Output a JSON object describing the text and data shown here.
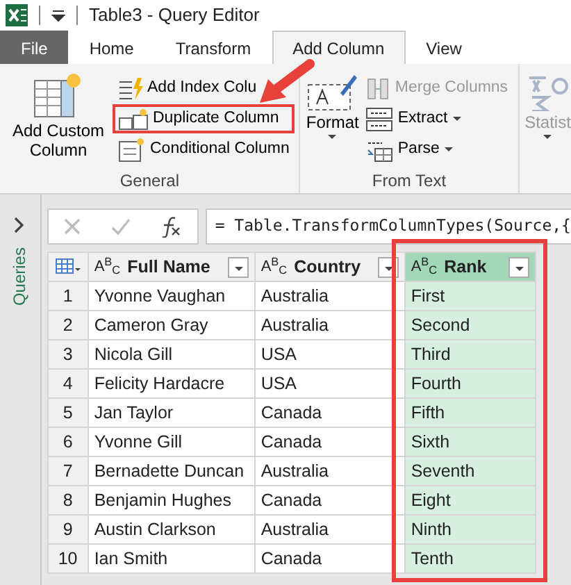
{
  "title_bar": {
    "title": "Table3 - Query Editor"
  },
  "tabs": [
    {
      "label": "File",
      "kind": "file",
      "selected": false
    },
    {
      "label": "Home",
      "kind": "tab",
      "selected": false
    },
    {
      "label": "Transform",
      "kind": "tab",
      "selected": false
    },
    {
      "label": "Add Column",
      "kind": "tab",
      "selected": true
    },
    {
      "label": "View",
      "kind": "tab",
      "selected": false
    }
  ],
  "ribbon": {
    "groups": [
      {
        "label": "General",
        "items": [
          {
            "kind": "large",
            "label": "Add Custom Column",
            "disabled": false,
            "dropdown": false,
            "highlighted": false
          },
          {
            "kind": "small",
            "label": "Add Index Colu",
            "disabled": false,
            "dropdown": false,
            "highlighted": false
          },
          {
            "kind": "small",
            "label": "Duplicate Column",
            "disabled": false,
            "dropdown": false,
            "highlighted": true
          },
          {
            "kind": "small",
            "label": "Conditional Column",
            "disabled": false,
            "dropdown": false,
            "highlighted": false
          }
        ]
      },
      {
        "label": "From Text",
        "items": [
          {
            "kind": "large",
            "label": "Format",
            "disabled": false,
            "dropdown": true,
            "highlighted": false
          },
          {
            "kind": "small",
            "label": "Merge Columns",
            "disabled": true,
            "dropdown": false,
            "highlighted": false
          },
          {
            "kind": "small",
            "label": "Extract",
            "disabled": false,
            "dropdown": true,
            "highlighted": false
          },
          {
            "kind": "small",
            "label": "Parse",
            "disabled": false,
            "dropdown": true,
            "highlighted": false
          }
        ]
      },
      {
        "items": [
          {
            "kind": "large",
            "label": "Statist",
            "disabled": true,
            "dropdown": true,
            "highlighted": false
          }
        ]
      }
    ]
  },
  "annotation_arrow": true,
  "queries_pane": {
    "label": "Queries"
  },
  "formula_bar": {
    "formula": "= Table.TransformColumnTypes(Source,{"
  },
  "table": {
    "columns": [
      {
        "type": "A$^{B}$$_{C}$",
        "name": "Full Name",
        "selected": false,
        "highlighted": false
      },
      {
        "type": "A$^{B}$$_{C}$",
        "name": "Country",
        "selected": false,
        "highlighted": false
      },
      {
        "type": "A$^{B}$$_{C}$",
        "name": "Rank",
        "selected": true,
        "highlighted": true
      }
    ],
    "rows": [
      {
        "number": "1",
        "cells": [
          "Yvonne Vaughan",
          "Australia",
          "First"
        ]
      },
      {
        "number": "2",
        "cells": [
          "Cameron Gray",
          "Australia",
          "Second"
        ]
      },
      {
        "number": "3",
        "cells": [
          "Nicola Gill",
          "USA",
          "Third"
        ]
      },
      {
        "number": "4",
        "cells": [
          "Felicity Hardacre",
          "USA",
          "Fourth"
        ]
      },
      {
        "number": "5",
        "cells": [
          "Jan Taylor",
          "Canada",
          "Fifth"
        ]
      },
      {
        "number": "6",
        "cells": [
          "Yvonne Gill",
          "Canada",
          "Sixth"
        ]
      },
      {
        "number": "7",
        "cells": [
          "Bernadette Duncan",
          "Australia",
          "Seventh"
        ]
      },
      {
        "number": "8",
        "cells": [
          "Benjamin Hughes",
          "Canada",
          "Eight"
        ]
      },
      {
        "number": "9",
        "cells": [
          "Austin Clarkson",
          "Australia",
          "Ninth"
        ]
      },
      {
        "number": "10",
        "cells": [
          "Ian Smith",
          "Canada",
          "Tenth"
        ]
      }
    ]
  }
}
